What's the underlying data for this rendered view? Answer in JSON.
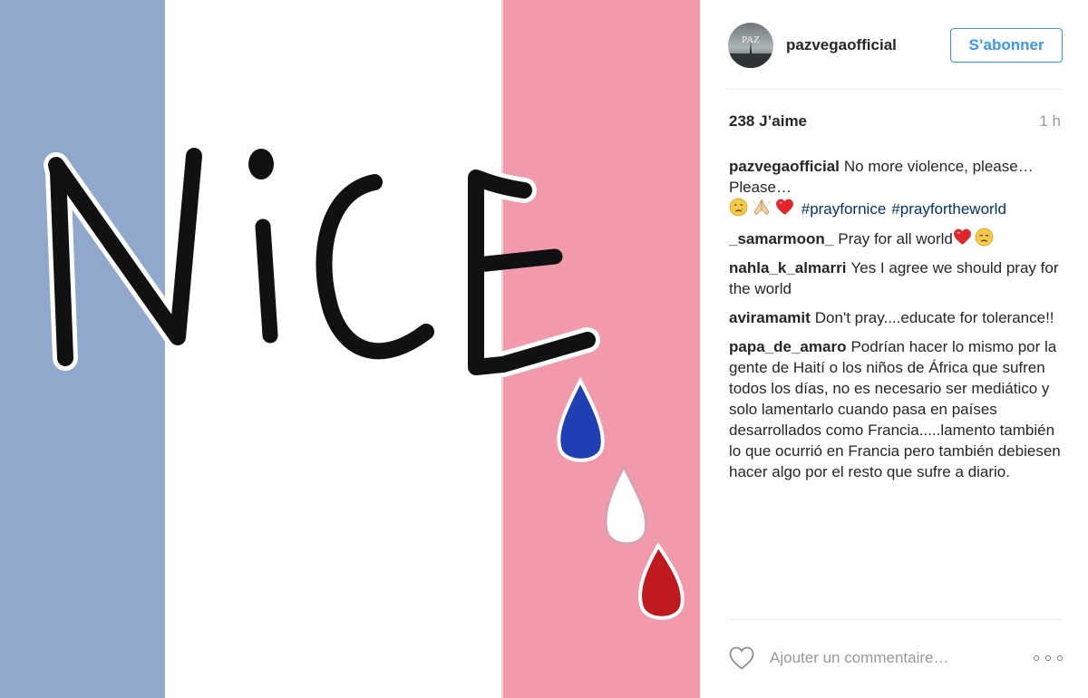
{
  "post": {
    "image": {
      "word": "NICE",
      "flag_colors": {
        "blue": "#8fa8cc",
        "white": "#ffffff",
        "pink": "#f29aac"
      },
      "tear_colors": [
        "#1f3fb5",
        "#ffffff",
        "#c0191f"
      ]
    },
    "header": {
      "avatar_text": "PAZ",
      "username": "pazvegaofficial",
      "follow_label": "S’abonner"
    },
    "stats": {
      "likes": "238 J’aime",
      "time": "1 h"
    },
    "caption": {
      "user": "pazvegaofficial",
      "text": "No more violence, please… Please…",
      "emoji_icons": [
        "crying-face-icon",
        "praying-hands-icon",
        "red-heart-icon"
      ],
      "hashtags": [
        "#prayfornice",
        "#prayfortheworld"
      ]
    },
    "comments": [
      {
        "user": "_samarmoon_",
        "text": "Pray for all world",
        "emoji_icons": [
          "red-heart-icon",
          "disappointed-face-icon"
        ]
      },
      {
        "user": "nahla_k_almarri",
        "text": "Yes I agree we should pray for the world"
      },
      {
        "user": "aviramamit",
        "text": "Don't pray....educate for tolerance!!"
      },
      {
        "user": "papa_de_amaro",
        "text": "Podrían hacer lo mismo por la gente de Haití o los niños de África que sufren todos los días, no es necesario ser mediático y solo lamentarlo cuando pasa en países desarrollados como Francia.....lamento también lo que ocurrió en Francia pero también debiesen hacer algo por el resto que sufre a diario."
      }
    ],
    "footer": {
      "comment_placeholder": "Ajouter un commentaire…",
      "like_icon": "heart-outline-icon",
      "more_icon": "more-options-icon"
    },
    "colors": {
      "accent": "#3897f0",
      "hashtag": "#003569",
      "muted": "#999999",
      "text": "#262626"
    }
  }
}
